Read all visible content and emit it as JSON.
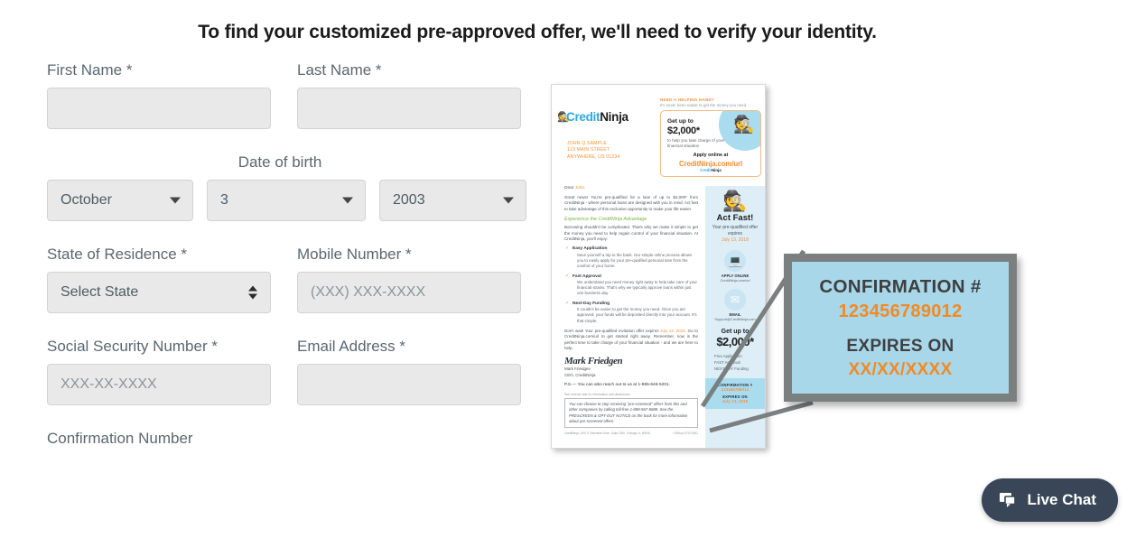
{
  "headline": "To find your customized pre-approved offer, we'll need to verify your identity.",
  "form": {
    "first_name": {
      "label": "First Name *",
      "value": "",
      "placeholder": ""
    },
    "last_name": {
      "label": "Last Name *",
      "value": "",
      "placeholder": ""
    },
    "dob": {
      "label": "Date of birth",
      "month": "October",
      "day": "3",
      "year": "2003"
    },
    "state": {
      "label": "State of Residence *",
      "value": "Select State"
    },
    "mobile": {
      "label": "Mobile Number *",
      "value": "",
      "placeholder": "(XXX) XXX-XXXX"
    },
    "ssn": {
      "label": "Social Security Number *",
      "value": "",
      "placeholder": "XXX-XX-XXXX"
    },
    "email": {
      "label": "Email Address *",
      "value": "",
      "placeholder": ""
    },
    "confirmation": {
      "label": "Confirmation Number"
    }
  },
  "letter": {
    "logo_credit": "Credit",
    "logo_ninja": "Ninja",
    "address": "JOHN Q SAMPLE\n123 MAIN STREET\nANYWHERE, US 01234",
    "need_hand_title": "NEED A HELPING HAND?",
    "need_hand_sub": "It's never been easier to get the money you need.",
    "get_up_to": "Get up to",
    "amount": "$2,000*",
    "offer_sub": "to help you take charge of your financial situation",
    "apply_online_at": "Apply online at",
    "url_main": "CreditNinja.com/",
    "url_tail": "url",
    "dear": "Dear ",
    "dear_name": "John,",
    "para1": "Great news! You're pre-qualified for a loan of up to $2,000* from CreditNinja - where personal loans are designed with you in mind. Act fast to take advantage of this exclusive opportunity to make your life easier.",
    "subhead": "Experience the CreditNinja Advantage",
    "para2": "Borrowing shouldn't be complicated. That's why we make it simple to get the money you need to help regain control of your financial situation. At CreditNinja, you'll enjoy:",
    "bullets": [
      {
        "title": "Easy Application",
        "text": "Save yourself a trip to the bank. Our simple online process allows you to easily apply for your pre-qualified personal loan from the comfort of your home."
      },
      {
        "title": "Fast Approval",
        "text": "We understand you need money right away to help take care of your financial strains. That's why we typically approve loans within just one business day."
      },
      {
        "title": "Next-Day Funding",
        "text": "It couldn't be easier to get the money you need. Once you are approved, your funds will be deposited directly into your account. It's that simple."
      }
    ],
    "para3_a": "Don't wait! Your pre-qualified invitation offer expires ",
    "para3_date": "July 13, 2018",
    "para3_b": ". Go to CreditNinja.com/url to get started right away. Remember, now is the perfect time to take charge of your financial situation - and we are here to help.",
    "signature": "Mark Friedgen",
    "sig_name": "Mark Friedgen",
    "sig_title": "CEO, CreditNinja",
    "ps": "P.S.— You can also reach out to us at 1-855-646-5201.",
    "disclosure_head": "See reverse side for information and disclosures",
    "disclosure": "You can choose to stop receiving \"pre-screened\" offers from this and other companies by calling toll-free 1-888-567-8688. See the PRESCREEN & OPT-OUT NOTICE on the back for more information about pre-screened offers.",
    "footer_left": "CreditNinja | 300 S. Riverside Drive, Suite 2300, Chicago, IL 60606",
    "footer_right": "CNStud-0719-3541",
    "rail": {
      "act_fast": "Act Fast!",
      "expires_label": "Your pre-qualified offer expires",
      "expires_date": "July 13, 2018",
      "apply_online": "APPLY ONLINE",
      "apply_online_url": "CreditNinja.com/url",
      "email_label": "EMAIL",
      "email_value": "Support@CreditNinja.com",
      "get_up_to": "Get up to",
      "amount": "$2,000*",
      "benefits": "Free Application\nFAST Approval\nNEXT-DAY Funding",
      "conf_head": "CONFIRMATION #",
      "conf_value": "123456789012",
      "exp_head": "EXPIRES ON",
      "exp_value": "July 13, 2018"
    }
  },
  "callout": {
    "confirmation_label": "CONFIRMATION #",
    "confirmation_value": "123456789012",
    "expires_label": "EXPIRES ON",
    "expires_value": "XX/XX/XXXX",
    "bg_color": "#a9d7ea",
    "accent_color": "#f08a24",
    "border_color": "#7a7f7f"
  },
  "live_chat": {
    "label": "Live Chat",
    "icon": "chat-bubble-icon",
    "bg_color": "#394657"
  }
}
